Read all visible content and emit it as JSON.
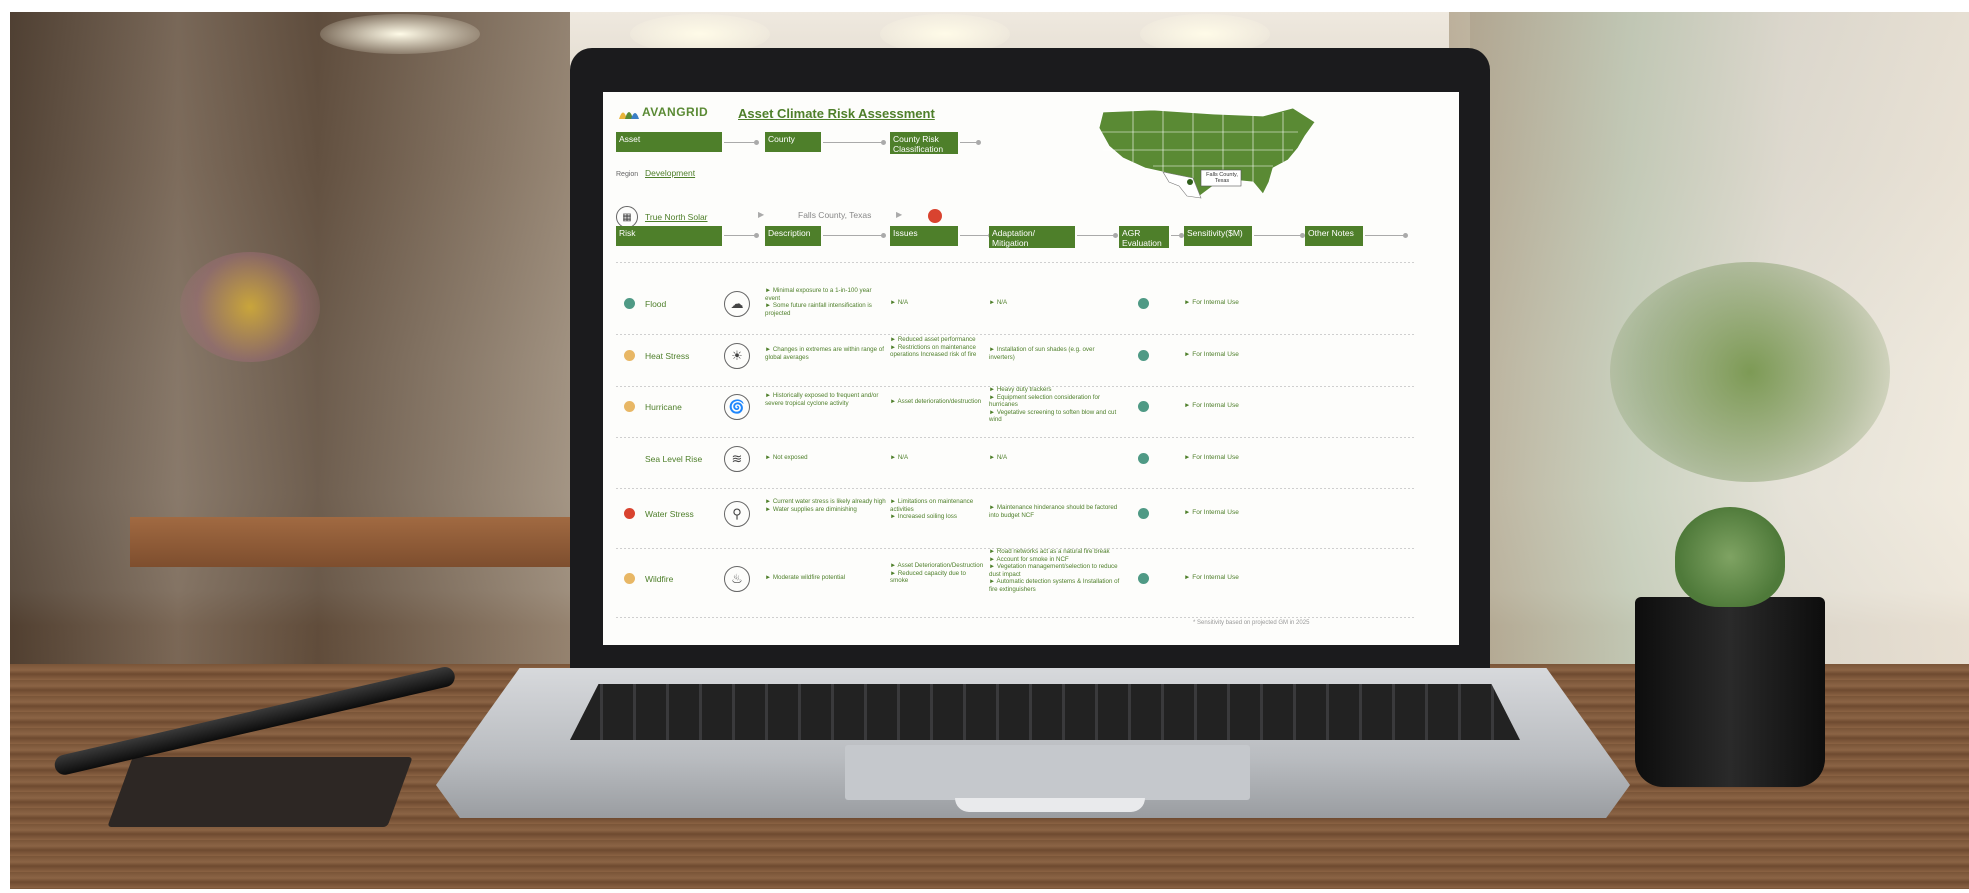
{
  "slide": {
    "brand": "AVANGRID",
    "title": "Asset Climate Risk Assessment",
    "header1": [
      "Asset",
      "County",
      "County Risk Classification"
    ],
    "region_label": "Region",
    "region_value": "Development",
    "asset_name": "True North Solar",
    "county_value": "Falls County, Texas",
    "map_label": "Falls County, Texas",
    "columns": [
      "Risk",
      "Description",
      "Issues",
      "Adaptation/ Mitigation",
      "AGR Evaluation",
      "Sensitivity($M)",
      "Other Notes"
    ],
    "rows": [
      {
        "risk": "Flood",
        "icon": "cloud-rain-icon",
        "glyph": "☁",
        "desc": "► Minimal exposure to a 1-in-100 year event\n► Some future rainfall intensification is projected",
        "issues": "► N/A",
        "adapt": "► N/A",
        "sens": "► For Internal Use"
      },
      {
        "risk": "Heat Stress",
        "icon": "sun-icon",
        "glyph": "☀",
        "desc": "► Changes in extremes are within range of global averages",
        "issues": "► Reduced asset performance\n► Restrictions on maintenance operations Increased risk of fire",
        "adapt": "► Installation of sun shades (e.g. over inverters)",
        "sens": "► For Internal Use"
      },
      {
        "risk": "Hurricane",
        "icon": "tornado-icon",
        "glyph": "🌀",
        "desc": "► Historically exposed to frequent and/or severe tropical cyclone activity",
        "issues": "► Asset deterioration/destruction",
        "adapt": "► Heavy duty trackers\n► Equipment selection consideration for hurricanes\n► Vegetative screening to soften blow and cut wind",
        "sens": "► For Internal Use"
      },
      {
        "risk": "Sea Level Rise",
        "icon": "wave-icon",
        "glyph": "≋",
        "desc": "► Not exposed",
        "issues": "► N/A",
        "adapt": "► N/A",
        "sens": "► For Internal Use"
      },
      {
        "risk": "Water Stress",
        "icon": "faucet-icon",
        "glyph": "⚲",
        "desc": "► Current water stress is likely already high\n► Water supplies are diminishing",
        "issues": "► Limitations on maintenance activities\n► Increased soiling loss",
        "adapt": "► Maintenance hinderance should be factored into budget NCF",
        "sens": "► For Internal Use"
      },
      {
        "risk": "Wildfire",
        "icon": "fire-icon",
        "glyph": "♨",
        "desc": "► Moderate wildfire potential",
        "issues": "► Asset Deterioration/Destruction\n► Reduced capacity due to smoke",
        "adapt": "► Road networks act as a natural fire break\n► Account for smoke in NCF\n► Vegetation management/selection to reduce dust impact\n► Automatic detection systems & Installation of fire extinguishers",
        "sens": "► For Internal Use"
      }
    ],
    "footnote": "* Sensitivity based on projected GM in 2025"
  },
  "colors": {
    "green": "#4e7f2a",
    "risk_red": "#d9432f",
    "risk_orange": "#e8b765",
    "agr_teal": "#4f9a85"
  }
}
